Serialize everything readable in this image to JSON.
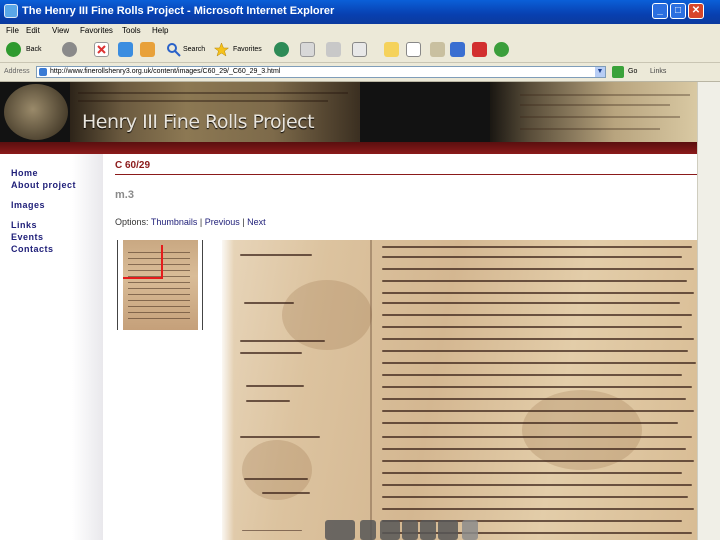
{
  "window": {
    "title": "The Henry III Fine Rolls Project - Microsoft Internet Explorer",
    "buttons": {
      "minimize": "_",
      "maximize": "□",
      "close": "✕"
    }
  },
  "menu": [
    "File",
    "Edit",
    "View",
    "Favorites",
    "Tools",
    "Help"
  ],
  "toolbar": {
    "back_label": "Back",
    "search_label": "Search",
    "favorites_label": "Favorites"
  },
  "address": {
    "label": "Address",
    "url": "http://www.finerollshenry3.org.uk/content/images/C60_29/_C60_29_3.html",
    "go_label": "Go",
    "links_label": "Links"
  },
  "banner": {
    "title": "Henry III Fine Rolls Project"
  },
  "sidebar": {
    "items": [
      "Home",
      "About project",
      "Images",
      "Links",
      "Events",
      "Contacts"
    ]
  },
  "content": {
    "heading": "C 60/29",
    "membrane": "m.3",
    "options_label": "Options:",
    "links": [
      "Thumbnails",
      "Previous",
      "Next"
    ],
    "separator": "|"
  },
  "icons": {
    "back": "back-arrow-icon",
    "forward": "forward-arrow-icon",
    "stop": "stop-icon",
    "refresh": "refresh-icon",
    "home": "home-icon",
    "search": "search-icon",
    "favorites": "star-icon",
    "media": "media-icon",
    "mail": "mail-icon",
    "print": "print-icon",
    "edit": "edit-icon",
    "discuss": "discuss-icon",
    "messenger": "messenger-icon"
  },
  "colors": {
    "accent": "#8b1a1a",
    "nav_link": "#1e1e78",
    "titlebar": "#0840b0"
  }
}
